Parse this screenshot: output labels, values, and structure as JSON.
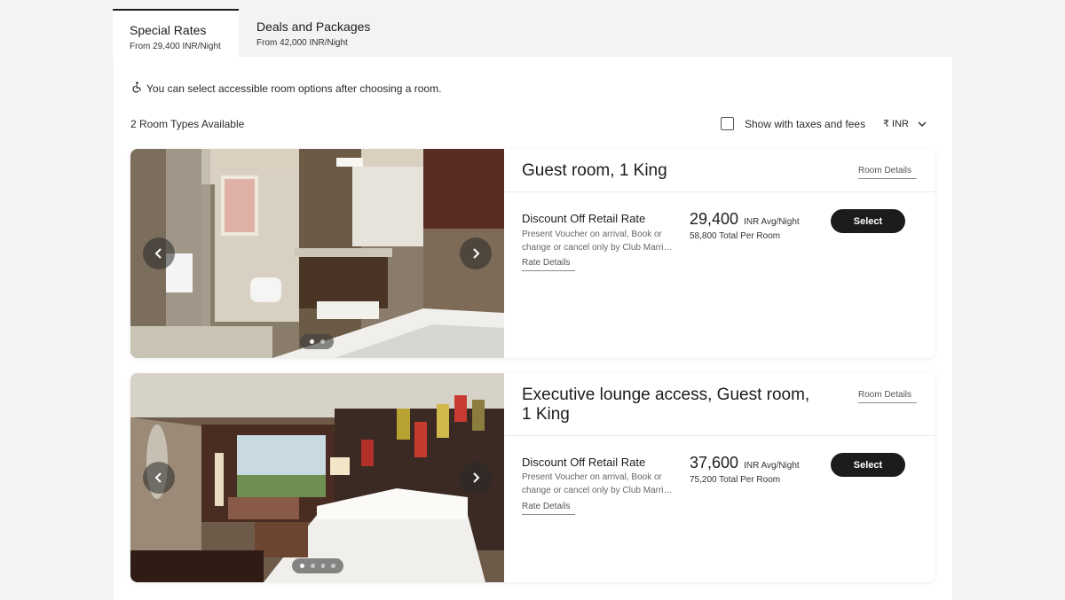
{
  "tabs": [
    {
      "title": "Special Rates",
      "subtitle": "From 29,400 INR/Night",
      "active": true
    },
    {
      "title": "Deals and Packages",
      "subtitle": "From 42,000 INR/Night",
      "active": false
    }
  ],
  "accessibility_note": "You can select accessible room options after choosing a room.",
  "room_count": "2 Room Types Available",
  "tax_toggle_label": "Show with taxes and fees",
  "currency": "₹ INR",
  "rooms": [
    {
      "name": "Guest room, 1 King",
      "room_details_link": "Room Details",
      "rate_name": "Discount Off Retail Rate",
      "rate_description": "Present Voucher on arrival, Book or change or cancel only by Club Marri…",
      "rate_details_link": "Rate Details",
      "price": "29,400",
      "price_unit": "INR Avg/Night",
      "total": "58,800 Total Per Room",
      "select_label": "Select",
      "carousel_dots": 2,
      "carousel_active": 0
    },
    {
      "name": "Executive lounge access, Guest room, 1 King",
      "room_details_link": "Room Details",
      "rate_name": "Discount Off Retail Rate",
      "rate_description": "Present Voucher on arrival, Book or change or cancel only by Club Marri…",
      "rate_details_link": "Rate Details",
      "price": "37,600",
      "price_unit": "INR Avg/Night",
      "total": "75,200 Total Per Room",
      "select_label": "Select",
      "carousel_dots": 4,
      "carousel_active": 0
    }
  ],
  "icons": {
    "accessibility": "wheelchair-icon",
    "prev": "chevron-left-icon",
    "next": "chevron-right-icon",
    "currency_dropdown": "chevron-down-icon"
  }
}
